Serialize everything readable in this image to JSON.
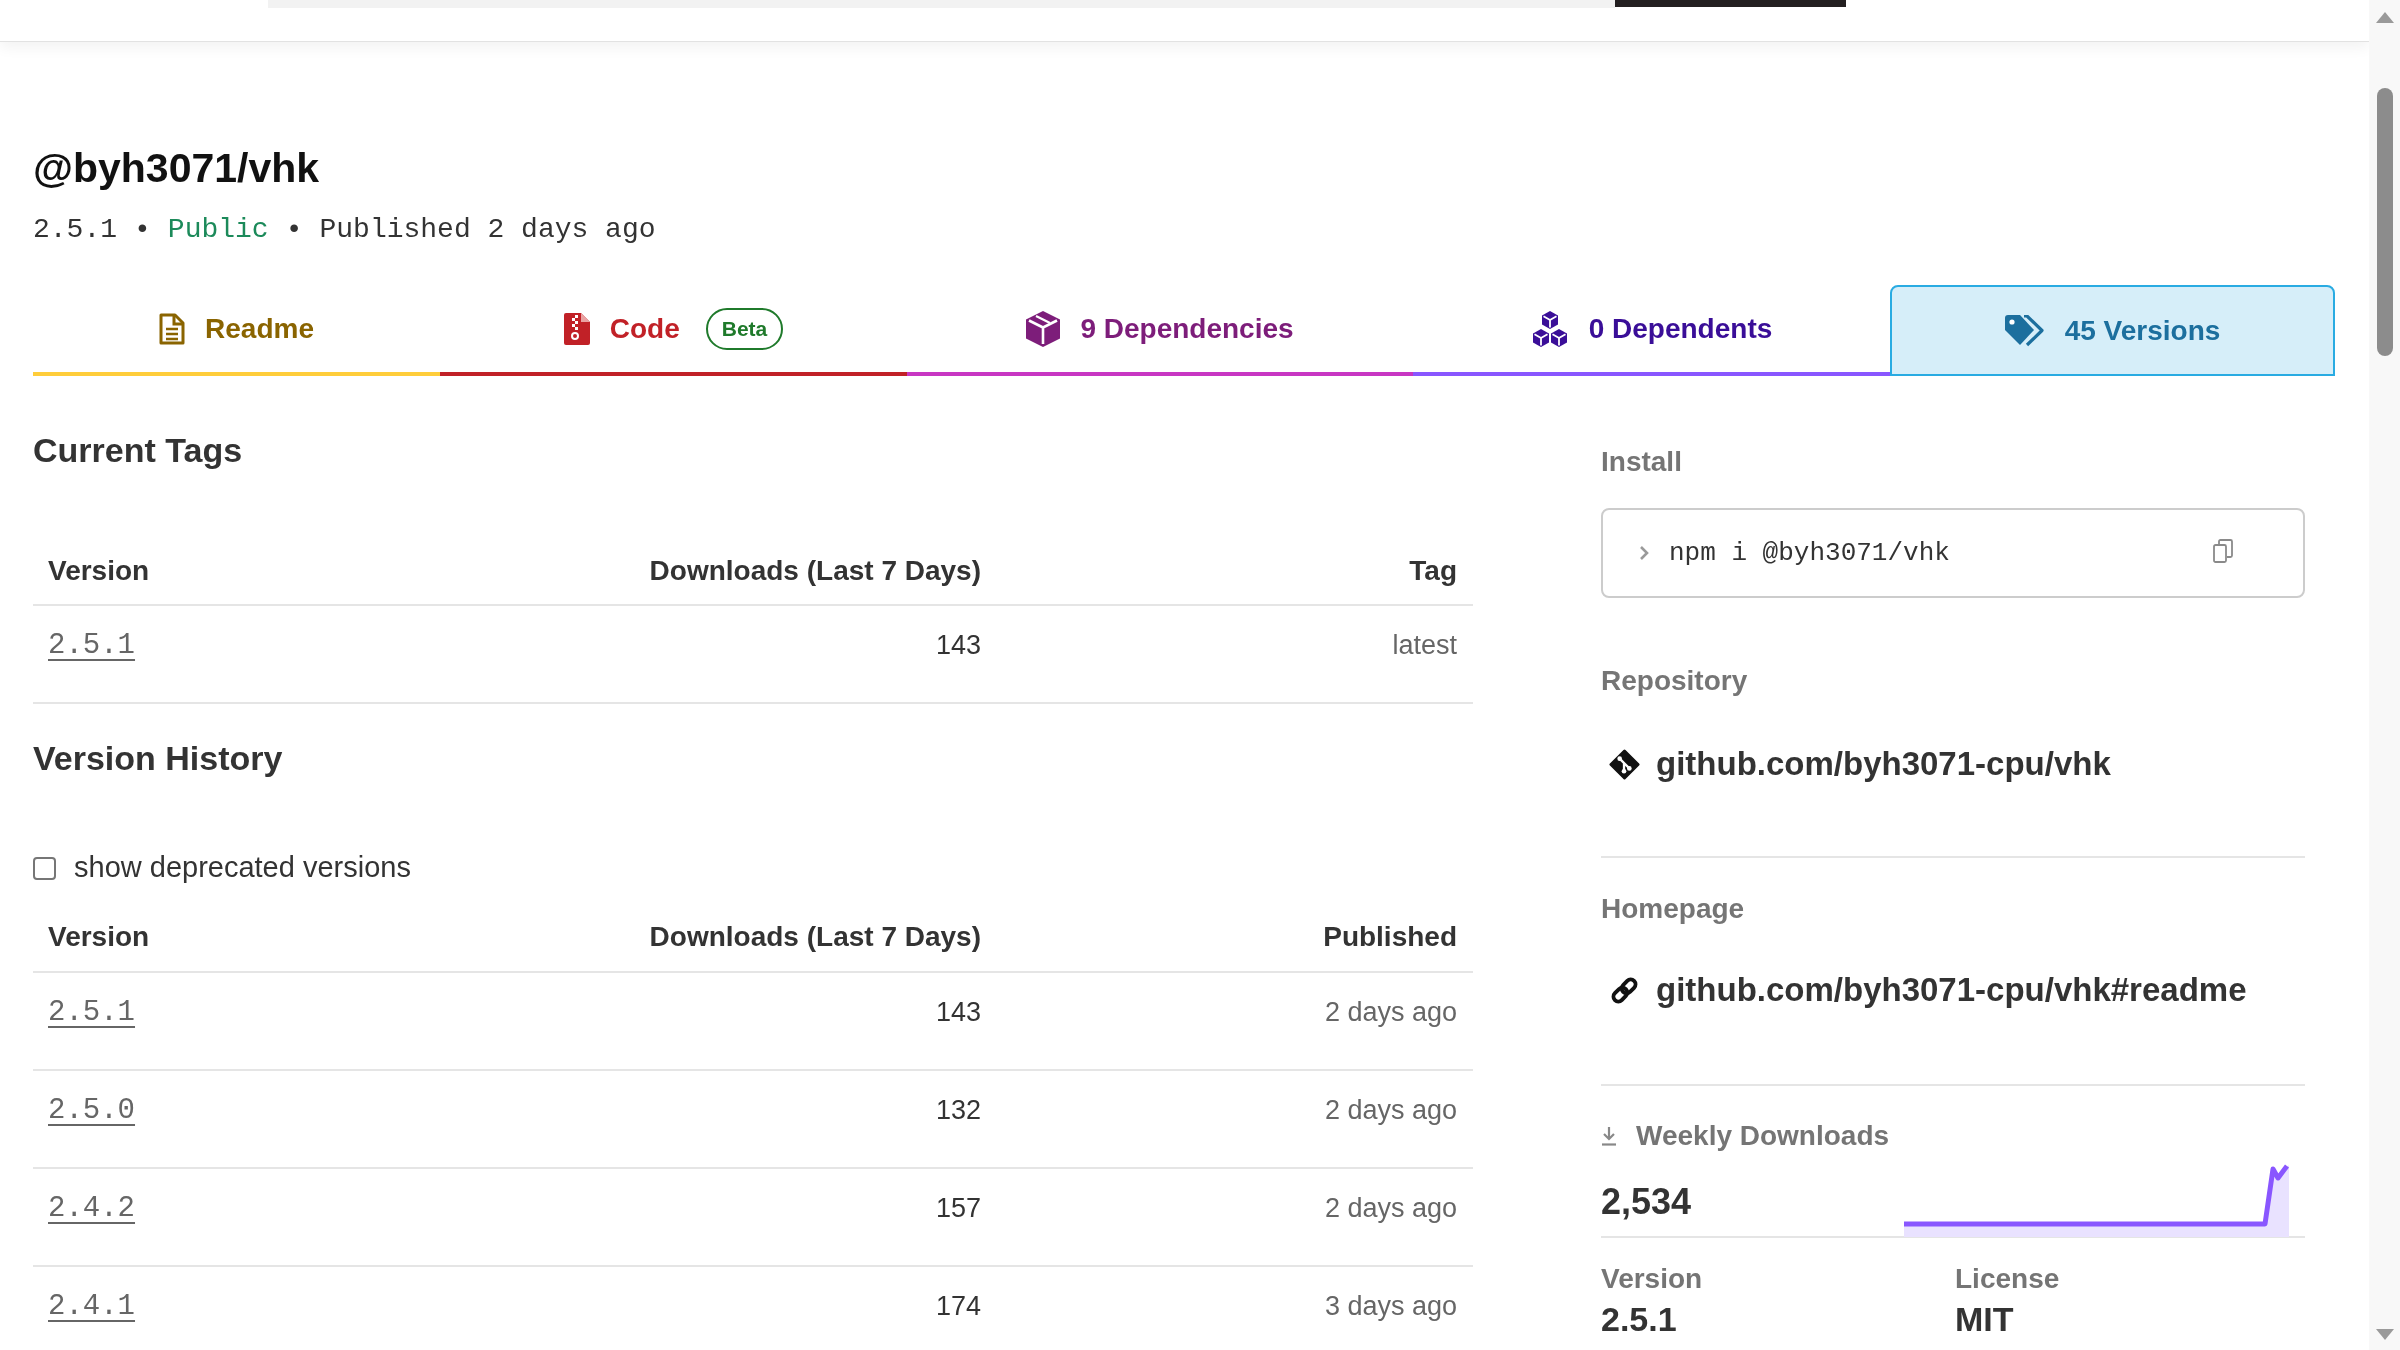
{
  "package": {
    "name": "@byh3071/vhk",
    "meta": [
      {
        "kind": "text",
        "text": "2.5.1"
      },
      {
        "kind": "separator",
        "text": "•"
      },
      {
        "kind": "visibility",
        "text": "Public"
      },
      {
        "kind": "separator",
        "text": "•"
      },
      {
        "kind": "text",
        "text": "Published 2 days ago"
      }
    ]
  },
  "tabs": [
    {
      "kind": "readme",
      "label": "Readme",
      "selected": false
    },
    {
      "kind": "code",
      "label": "Code",
      "badge": "Beta",
      "selected": false
    },
    {
      "kind": "dependencies",
      "label": "9 Dependencies",
      "selected": false
    },
    {
      "kind": "dependents",
      "label": "0 Dependents",
      "selected": false
    },
    {
      "kind": "versions",
      "label": "45 Versions",
      "selected": true
    }
  ],
  "current_tags": {
    "title": "Current Tags",
    "columns": [
      "Version",
      "Downloads (Last 7 Days)",
      "Tag"
    ],
    "rows": [
      {
        "version": "2.5.1",
        "downloads": "143",
        "tag": "latest"
      }
    ]
  },
  "version_history": {
    "title": "Version History",
    "show_deprecated": {
      "label": "show deprecated versions",
      "checked": false
    },
    "columns": [
      "Version",
      "Downloads (Last 7 Days)",
      "Published"
    ],
    "rows": [
      {
        "version": "2.5.1",
        "downloads": "143",
        "published": "2 days ago"
      },
      {
        "version": "2.5.0",
        "downloads": "132",
        "published": "2 days ago"
      },
      {
        "version": "2.4.2",
        "downloads": "157",
        "published": "2 days ago"
      },
      {
        "version": "2.4.1",
        "downloads": "174",
        "published": "3 days ago"
      }
    ]
  },
  "sidebar": {
    "install": {
      "title": "Install",
      "command": "npm i @byh3071/vhk"
    },
    "repository": {
      "title": "Repository",
      "link": "github.com/byh3071-cpu/vhk"
    },
    "homepage": {
      "title": "Homepage",
      "link": "github.com/byh3071-cpu/vhk#readme"
    },
    "weekly_downloads": {
      "title": "Weekly Downloads",
      "count": "2,534"
    },
    "details": [
      {
        "label": "Version",
        "value": "2.5.1"
      },
      {
        "label": "License",
        "value": "MIT"
      }
    ]
  }
}
